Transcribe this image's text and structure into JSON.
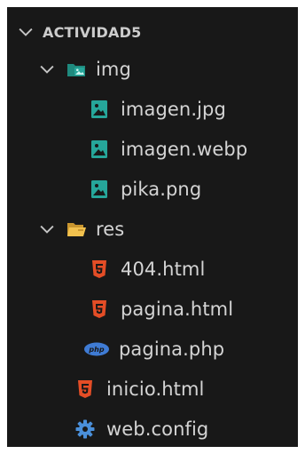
{
  "explorer": {
    "root": {
      "label": "ACTIVIDAD5",
      "expanded": true,
      "icon": "chevron-down-icon"
    },
    "items": [
      {
        "label": "img",
        "type": "folder",
        "expanded": true,
        "icon": "image-folder-icon"
      },
      {
        "label": "imagen.jpg",
        "type": "file",
        "icon": "image-file-icon"
      },
      {
        "label": "imagen.webp",
        "type": "file",
        "icon": "image-file-icon"
      },
      {
        "label": "pika.png",
        "type": "file",
        "icon": "image-file-icon"
      },
      {
        "label": "res",
        "type": "folder",
        "expanded": true,
        "icon": "resource-folder-icon"
      },
      {
        "label": "404.html",
        "type": "file",
        "icon": "html5-icon"
      },
      {
        "label": "pagina.html",
        "type": "file",
        "icon": "html5-icon"
      },
      {
        "label": "pagina.php",
        "type": "file",
        "icon": "php-icon"
      },
      {
        "label": "inicio.html",
        "type": "file",
        "icon": "html5-icon"
      },
      {
        "label": "web.config",
        "type": "file",
        "icon": "gear-icon"
      }
    ]
  },
  "colors": {
    "background": "#181818",
    "text": "#cccccc",
    "image_icon": "#26a69a",
    "html_icon": "#e44d26",
    "php_icon": "#3f7bd4",
    "folder_yellow": "#e8b84a",
    "gear": "#4a8fd9"
  }
}
